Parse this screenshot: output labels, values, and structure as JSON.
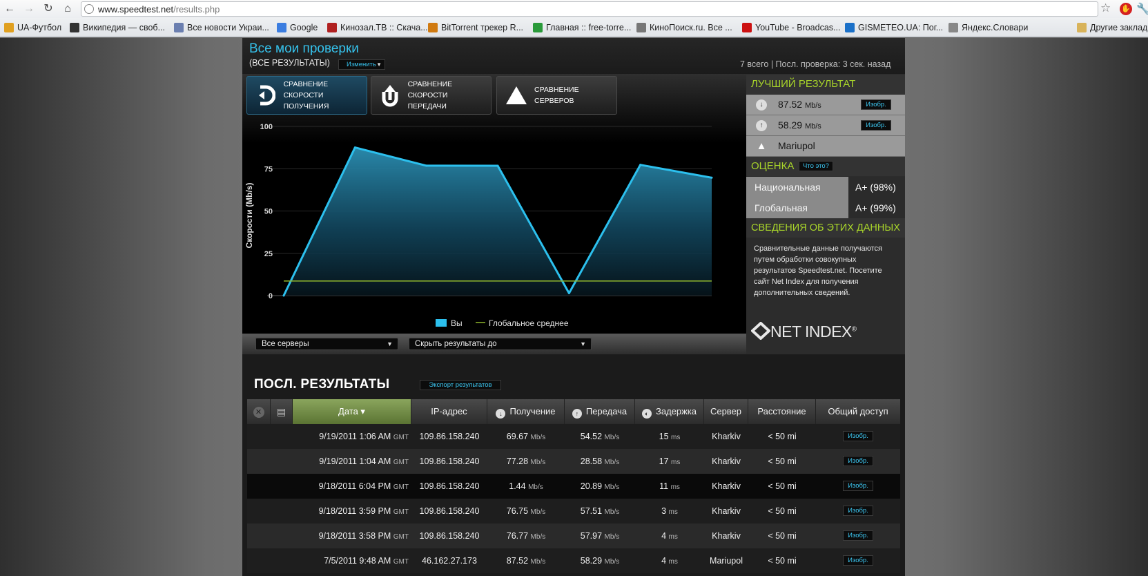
{
  "browser": {
    "url_host": "www.speedtest.net",
    "url_path": "/results.php",
    "bookmarks": [
      {
        "label": "UA-Футбол",
        "icon": "ua-football-icon",
        "color": "#e0a020"
      },
      {
        "label": "Википедия — своб...",
        "icon": "wikipedia-icon",
        "color": "#333333"
      },
      {
        "label": "Все новости Украи...",
        "icon": "news-icon",
        "color": "#6b7fb0"
      },
      {
        "label": "Google",
        "icon": "google-icon",
        "color": "#3b7de0"
      },
      {
        "label": "Кинозал.ТВ :: Скача...",
        "icon": "kinozal-icon",
        "color": "#b02020"
      },
      {
        "label": "BitTorrent трекер R...",
        "icon": "rutracker-icon",
        "color": "#d07a10"
      },
      {
        "label": "Главная :: free-torre...",
        "icon": "free-torrents-icon",
        "color": "#2a9a3a"
      },
      {
        "label": "КиноПоиск.ru. Все ...",
        "icon": "kinopoisk-icon",
        "color": "#777777"
      },
      {
        "label": "YouTube - Broadcas...",
        "icon": "youtube-icon",
        "color": "#cc1111"
      },
      {
        "label": "GISMETEO.UA: Пог...",
        "icon": "gismeteo-icon",
        "color": "#1a70c8"
      },
      {
        "label": "Яндекс.Словари",
        "icon": "yandex-dictionary-icon",
        "color": "#888888"
      },
      {
        "label": "Другие заклад",
        "icon": "folder-icon",
        "color": "#d8b35a"
      }
    ]
  },
  "header": {
    "title": "Все мои проверки",
    "subtitle": "(ВСЕ РЕЗУЛЬТАТЫ)",
    "change_label": "Изменить",
    "summary": "7 всего | Посл. проверка: 3 сек. назад"
  },
  "tabs": [
    {
      "line1": "СРАВНЕНИЕ СКОРОСТИ",
      "line2": "ПОЛУЧЕНИЯ",
      "icon": "download-compare-icon"
    },
    {
      "line1": "СРАВНЕНИЕ СКОРОСТИ",
      "line2": "ПЕРЕДАЧИ",
      "icon": "upload-compare-icon"
    },
    {
      "line1": "СРАВНЕНИЕ",
      "line2": "СЕРВЕРОВ",
      "icon": "servers-compare-icon"
    }
  ],
  "chart_data": {
    "type": "area",
    "ylabel": "Скорости (Mb/s)",
    "ylim": [
      0,
      100
    ],
    "yticks": [
      "100",
      "75",
      "50",
      "25",
      "0"
    ],
    "ytick_values": [
      100,
      75,
      50,
      25,
      0
    ],
    "x_count": 7,
    "series": [
      {
        "name": "Вы",
        "values": [
          0,
          87.52,
          76.77,
          76.75,
          1.44,
          77.28,
          69.67
        ],
        "color": "#2cc0ee"
      },
      {
        "name": "Глобальное среднее",
        "values": [
          8.6,
          8.6,
          8.6,
          8.6,
          8.6,
          8.6,
          8.6
        ],
        "color": "#8fb62c"
      }
    ],
    "legend_position": "bottom-center",
    "grid": true
  },
  "filters": {
    "servers": "Все серверы",
    "hide": "Скрыть результаты до"
  },
  "side": {
    "best_title": "ЛУЧШИЙ РЕЗУЛЬТАТ",
    "best_rows": [
      {
        "icon": "download-icon",
        "value": "87.52",
        "unit": "Mb/s",
        "button": "Изобр."
      },
      {
        "icon": "upload-icon",
        "value": "58.29",
        "unit": "Mb/s",
        "button": "Изобр."
      },
      {
        "icon": "server-icon",
        "value": "Mariupol",
        "unit": "",
        "button": ""
      }
    ],
    "grade_title": "ОЦЕНКА",
    "what_label": "Что это?",
    "grades": [
      {
        "label": "Национальная",
        "value": "A+ (98%)"
      },
      {
        "label": "Глобальная",
        "value": "A+ (99%)"
      }
    ],
    "info_title": "СВЕДЕНИЯ ОБ ЭТИХ ДАННЫХ",
    "info_text": "Сравнительные данные получаются путем обработки совокупных результатов Speedtest.net. Посетите сайт Net Index для получения дополнительных сведений.",
    "netindex_label": "NET INDEX",
    "netindex_mark": "®"
  },
  "results": {
    "title": "ПОСЛ. РЕЗУЛЬТАТЫ",
    "export_label": "Экспорт результатов",
    "columns": {
      "date": "Дата ▾",
      "ip": "IP-адрес",
      "download": "Получение",
      "upload": "Передача",
      "ping": "Задержка",
      "server": "Сервер",
      "distance": "Расстояние",
      "share": "Общий доступ"
    },
    "rows": [
      {
        "date": "9/19/2011 1:06 AM",
        "tz": "GMT",
        "ip": "109.86.158.240",
        "down": "69.67",
        "up": "54.52",
        "ping": "15",
        "server": "Kharkiv",
        "distance": "< 50 mi",
        "share": "Изобр."
      },
      {
        "date": "9/19/2011 1:04 AM",
        "tz": "GMT",
        "ip": "109.86.158.240",
        "down": "77.28",
        "up": "28.58",
        "ping": "17",
        "server": "Kharkiv",
        "distance": "< 50 mi",
        "share": "Изобр."
      },
      {
        "date": "9/18/2011 6:04 PM",
        "tz": "GMT",
        "ip": "109.86.158.240",
        "down": "1.44",
        "up": "20.89",
        "ping": "11",
        "server": "Kharkiv",
        "distance": "< 50 mi",
        "share": "Изобр."
      },
      {
        "date": "9/18/2011 3:59 PM",
        "tz": "GMT",
        "ip": "109.86.158.240",
        "down": "76.75",
        "up": "57.51",
        "ping": "3",
        "server": "Kharkiv",
        "distance": "< 50 mi",
        "share": "Изобр."
      },
      {
        "date": "9/18/2011 3:58 PM",
        "tz": "GMT",
        "ip": "109.86.158.240",
        "down": "76.77",
        "up": "57.97",
        "ping": "4",
        "server": "Kharkiv",
        "distance": "< 50 mi",
        "share": "Изобр."
      },
      {
        "date": "7/5/2011 9:48 AM",
        "tz": "GMT",
        "ip": "46.162.27.173",
        "down": "87.52",
        "up": "58.29",
        "ping": "4",
        "server": "Mariupol",
        "distance": "< 50 mi",
        "share": "Изобр."
      }
    ],
    "unit_speed": "Mb/s",
    "unit_ping": "ms"
  }
}
